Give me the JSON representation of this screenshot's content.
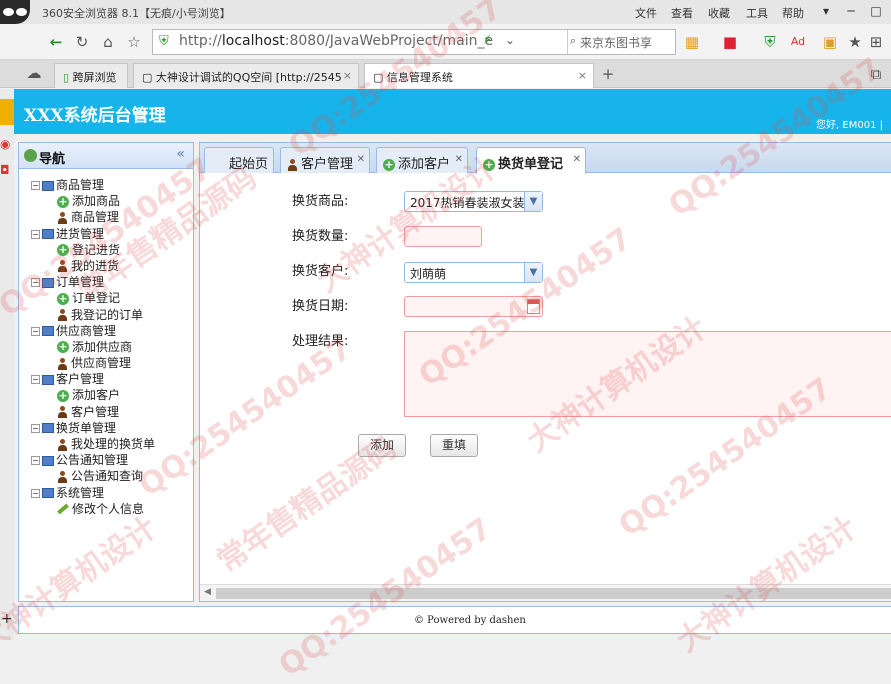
{
  "browser": {
    "title": "360安全浏览器 8.1【无痕/小号浏览】",
    "menu": [
      "文件",
      "查看",
      "收藏",
      "工具",
      "帮助"
    ],
    "url_prefix": "http://",
    "url_host": "localhost",
    "url_rest": ":8080/JavaWebProject/main_e",
    "search_placeholder": "来京东图书享",
    "tabs": [
      {
        "label": "跨屏浏览"
      },
      {
        "label": "大神设计调试的QQ空间 [http://2545"
      },
      {
        "label": "信息管理系统"
      }
    ]
  },
  "header": {
    "title": "XXX系统后台管理",
    "greeting": "您好, EM001 |"
  },
  "nav": {
    "title": "导航",
    "groups": [
      {
        "label": "商品管理",
        "items": [
          {
            "label": "添加商品",
            "icon": "add"
          },
          {
            "label": "商品管理",
            "icon": "user"
          }
        ]
      },
      {
        "label": "进货管理",
        "items": [
          {
            "label": "登记进货",
            "icon": "add"
          },
          {
            "label": "我的进货",
            "icon": "user"
          }
        ]
      },
      {
        "label": "订单管理",
        "items": [
          {
            "label": "订单登记",
            "icon": "add"
          },
          {
            "label": "我登记的订单",
            "icon": "user"
          }
        ]
      },
      {
        "label": "供应商管理",
        "items": [
          {
            "label": "添加供应商",
            "icon": "add"
          },
          {
            "label": "供应商管理",
            "icon": "user"
          }
        ]
      },
      {
        "label": "客户管理",
        "items": [
          {
            "label": "添加客户",
            "icon": "add"
          },
          {
            "label": "客户管理",
            "icon": "user"
          }
        ]
      },
      {
        "label": "换货单管理",
        "items": [
          {
            "label": "换货单登记",
            "icon": "add",
            "selected": true
          },
          {
            "label": "我处理的换货单",
            "icon": "user"
          }
        ]
      },
      {
        "label": "公告通知管理",
        "items": [
          {
            "label": "公告通知查询",
            "icon": "user"
          }
        ]
      },
      {
        "label": "系统管理",
        "items": [
          {
            "label": "修改个人信息",
            "icon": "pencil"
          }
        ]
      }
    ]
  },
  "tabs": [
    {
      "label": "起始页",
      "closable": false
    },
    {
      "label": "客户管理",
      "closable": true
    },
    {
      "label": "添加客户",
      "closable": true
    },
    {
      "label": "换货单登记",
      "closable": true,
      "active": true
    }
  ],
  "form": {
    "product_label": "换货商品:",
    "product_value": "2017热销春装淑女装",
    "quantity_label": "换货数量:",
    "quantity_value": "",
    "customer_label": "换货客户:",
    "customer_value": "刘萌萌",
    "date_label": "换货日期:",
    "date_value": "",
    "result_label": "处理结果:",
    "result_value": "",
    "add_button": "添加",
    "reset_button": "重填"
  },
  "footer": {
    "text": "© Powered by dashen"
  },
  "watermarks": [
    "QQ:254540457",
    "大神计算机设计",
    "常年售精品源码"
  ],
  "colors": {
    "header": "#16b4ea",
    "panel_border": "#99bbe8",
    "selected_node": "#fbe38c",
    "invalid_field": "#f39d9d"
  }
}
